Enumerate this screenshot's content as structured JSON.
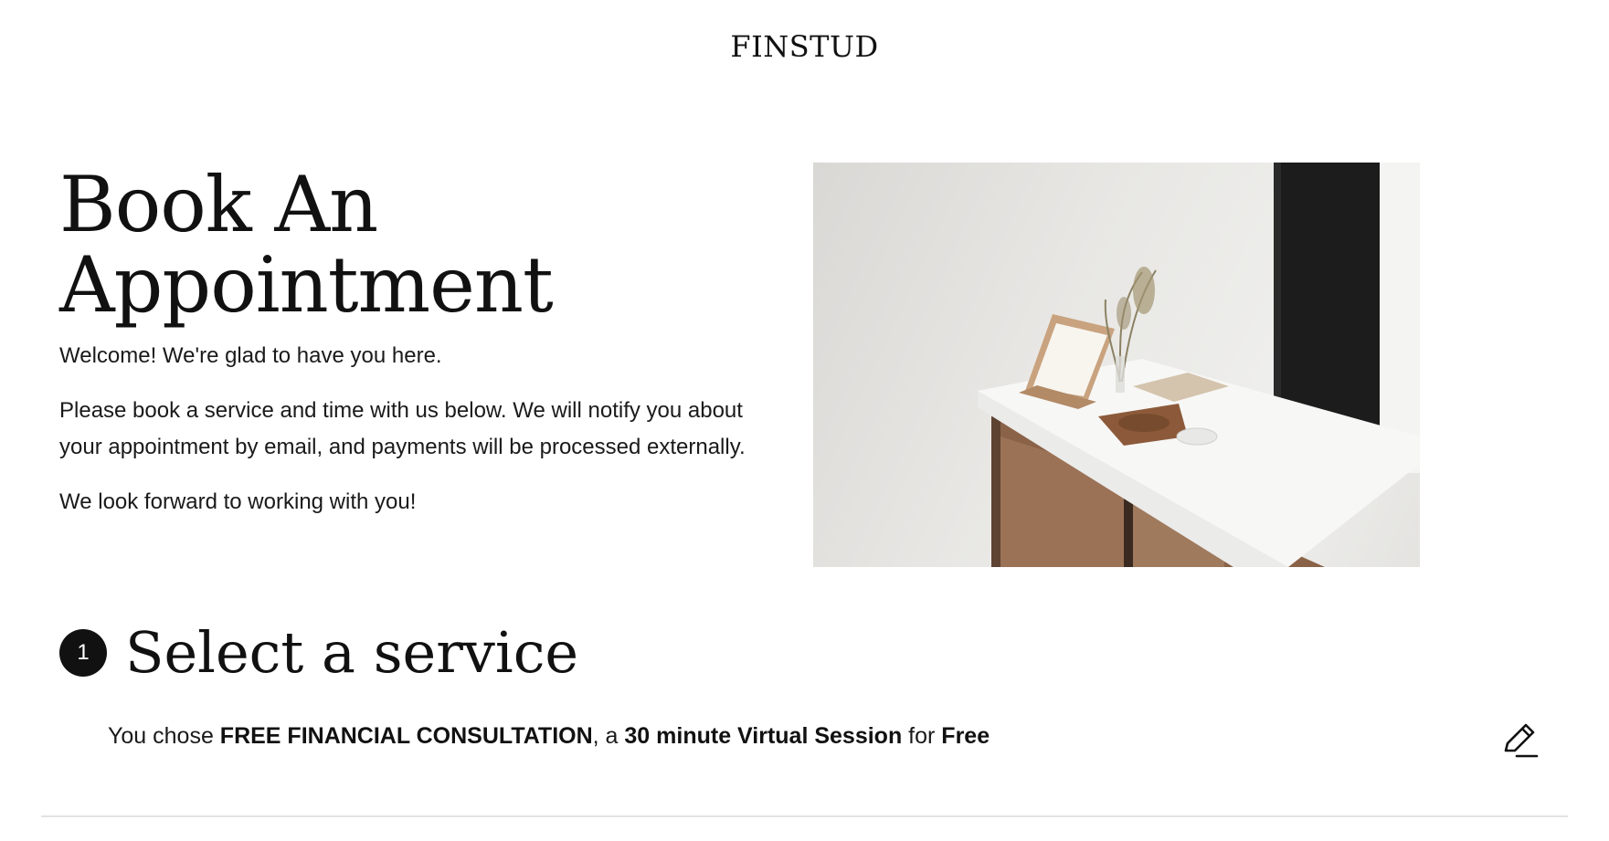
{
  "header": {
    "logo": "FINSTUD"
  },
  "hero": {
    "title_line1": "Book An",
    "title_line2": "Appointment",
    "welcome": "Welcome! We're glad to have you here.",
    "instructions": "Please book a service and time with us below. We will notify you about your appointment by email, and payments will be processed externally.",
    "closing": "We look forward to working with you!"
  },
  "step1": {
    "number": "1",
    "title": "Select a service",
    "summary": {
      "prefix": "You chose ",
      "service": "FREE FINANCIAL CONSULTATION",
      "sep": ", a ",
      "duration": "30 minute Virtual Session",
      "for": " for ",
      "price": "Free"
    },
    "edit_icon": "pencil-icon"
  }
}
